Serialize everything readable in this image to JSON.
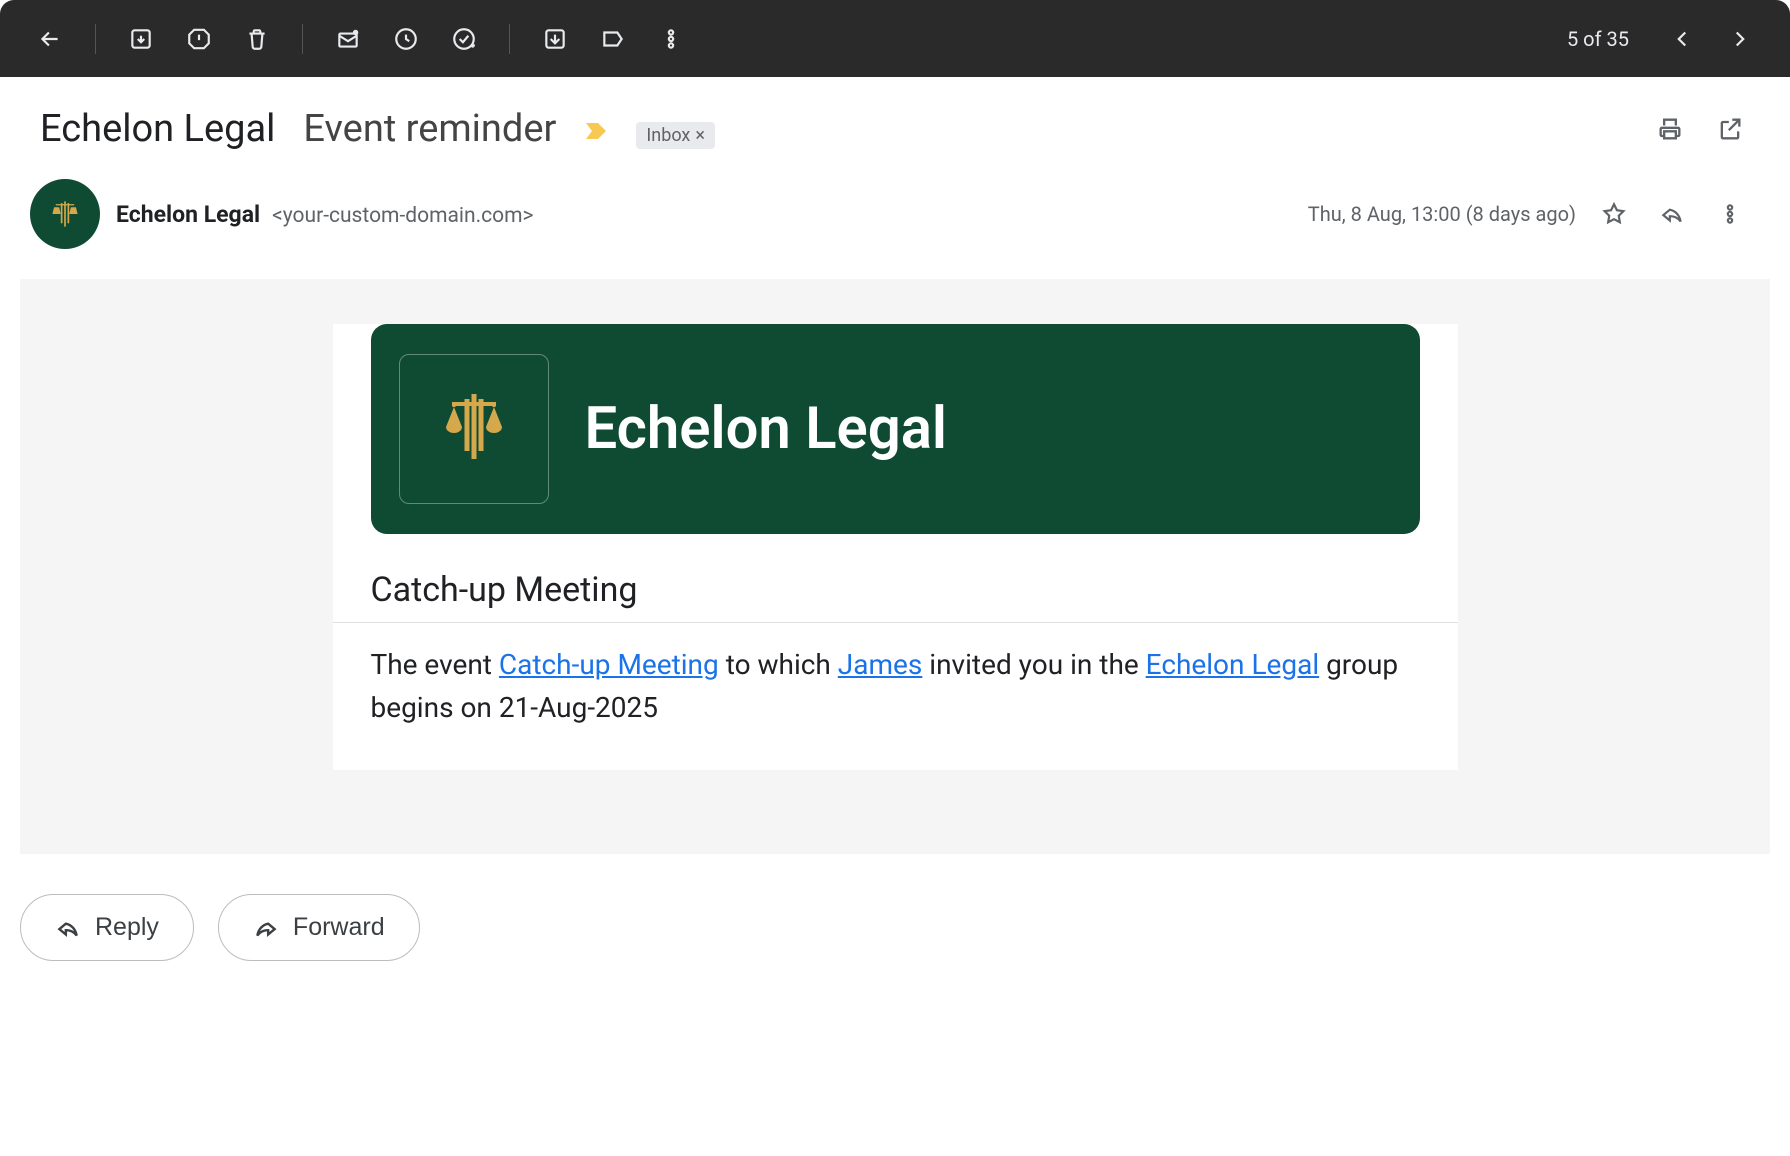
{
  "toolbar": {
    "pager": "5 of 35"
  },
  "header": {
    "subject_prefix": "Echelon Legal",
    "subject_main": "Event reminder",
    "label": "Inbox"
  },
  "sender": {
    "name": "Echelon Legal",
    "email": "<your-custom-domain.com>",
    "timestamp": "Thu, 8 Aug, 13:00 (8 days ago)"
  },
  "body": {
    "brand_title": "Echelon Legal",
    "event_title": "Catch-up Meeting",
    "desc_prefix": "The event ",
    "desc_event_link": "Catch-up Meeting",
    "desc_mid1": " to which ",
    "desc_inviter_link": "James",
    "desc_mid2": " invited you in the ",
    "desc_group_link": "Echelon Legal",
    "desc_suffix": " group begins on 21-Aug-2025"
  },
  "actions": {
    "reply": "Reply",
    "forward": "Forward"
  }
}
